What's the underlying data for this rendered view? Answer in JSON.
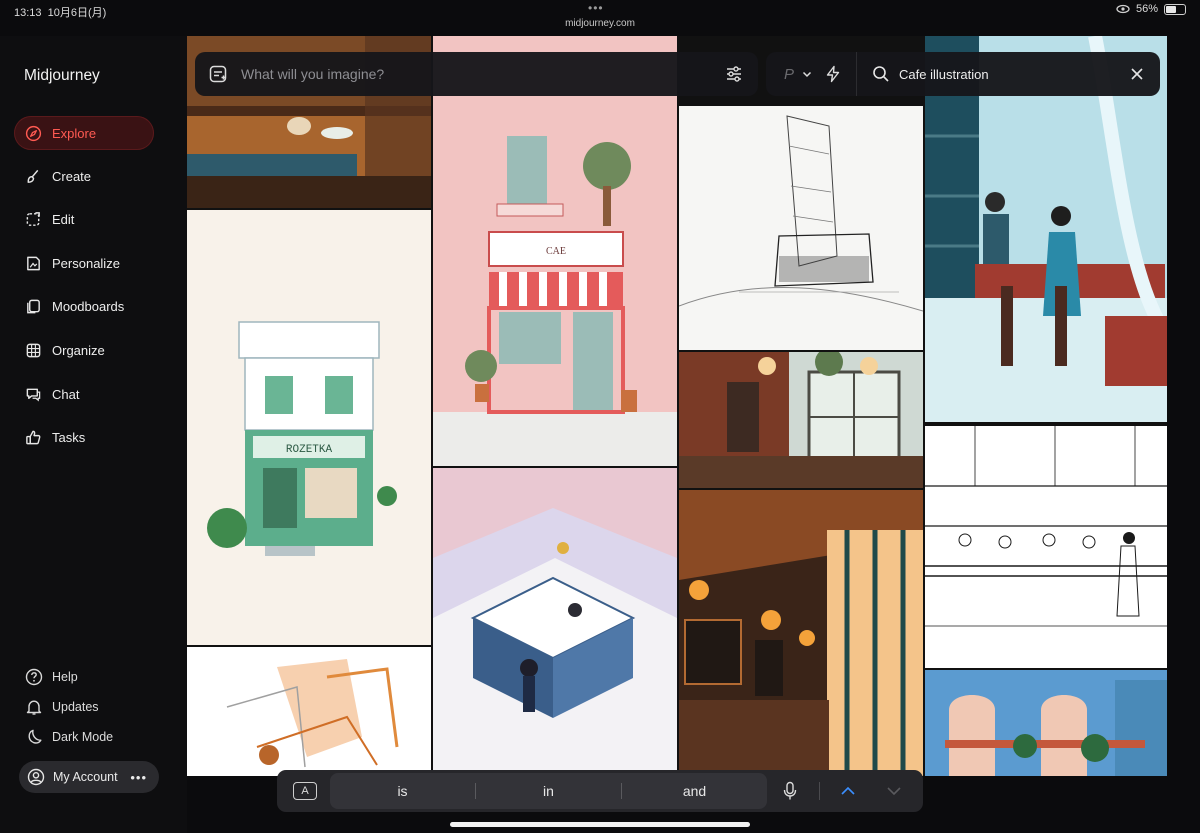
{
  "status": {
    "time": "13:13",
    "date": "10月6日(月)",
    "url": "midjourney.com",
    "battery": "56%",
    "battery_level": 0.56
  },
  "sidebar": {
    "brand": "Midjourney",
    "items": [
      {
        "label": "Explore",
        "icon": "compass-icon",
        "active": true
      },
      {
        "label": "Create",
        "icon": "brush-icon"
      },
      {
        "label": "Edit",
        "icon": "edit-icon"
      },
      {
        "label": "Personalize",
        "icon": "personalize-icon"
      },
      {
        "label": "Moodboards",
        "icon": "moodboard-icon"
      },
      {
        "label": "Organize",
        "icon": "grid-icon"
      },
      {
        "label": "Chat",
        "icon": "chat-icon"
      },
      {
        "label": "Tasks",
        "icon": "thumbs-up-icon"
      }
    ],
    "footer": [
      {
        "label": "Help",
        "icon": "help-icon"
      },
      {
        "label": "Updates",
        "icon": "bell-icon"
      },
      {
        "label": "Dark Mode",
        "icon": "moon-icon"
      }
    ],
    "account": {
      "label": "My Account",
      "more": "•••"
    }
  },
  "prompt": {
    "placeholder": "What will you imagine?"
  },
  "search": {
    "p_label": "P",
    "value": "Cafe illustration"
  },
  "keyboard": {
    "a_key": "A",
    "suggestions": [
      "is",
      "in",
      "and"
    ]
  },
  "gallery": {
    "tiles": [
      {
        "name": "cafe-table-photo",
        "colors": [
          "#6b3d22",
          "#a8652e",
          "#2e5a6b"
        ]
      },
      {
        "name": "rozetka-shop",
        "sign": "ROZETKA",
        "colors": [
          "#f8f2ea",
          "#5cae8c",
          "#ffffff"
        ]
      },
      {
        "name": "orange-sketch",
        "colors": [
          "#ffffff",
          "#e08a3c",
          "#9a9a9a"
        ]
      },
      {
        "name": "pink-cafe",
        "sign": "CAE",
        "colors": [
          "#f2c4c2",
          "#e45b5b",
          "#9bbcb7"
        ]
      },
      {
        "name": "isometric-cafe",
        "colors": [
          "#dcd6ec",
          "#3a5e8a",
          "#f3f2f5"
        ]
      },
      {
        "name": "line-sketch",
        "colors": [
          "#f6f6f4",
          "#222222"
        ]
      },
      {
        "name": "brick-cafe",
        "colors": [
          "#7a3a26",
          "#3d2a22",
          "#cfd9d3"
        ]
      },
      {
        "name": "warm-cafe",
        "colors": [
          "#3a2418",
          "#b36a32",
          "#f4c48a"
        ]
      },
      {
        "name": "retro-bar",
        "colors": [
          "#b9dfe8",
          "#1e4e5e",
          "#a13b30"
        ]
      },
      {
        "name": "counter-sketch",
        "colors": [
          "#ffffff",
          "#1a1a1a"
        ]
      },
      {
        "name": "arch-cafe",
        "colors": [
          "#5b9bd0",
          "#f0c8b4",
          "#2d6a3e"
        ]
      }
    ]
  }
}
